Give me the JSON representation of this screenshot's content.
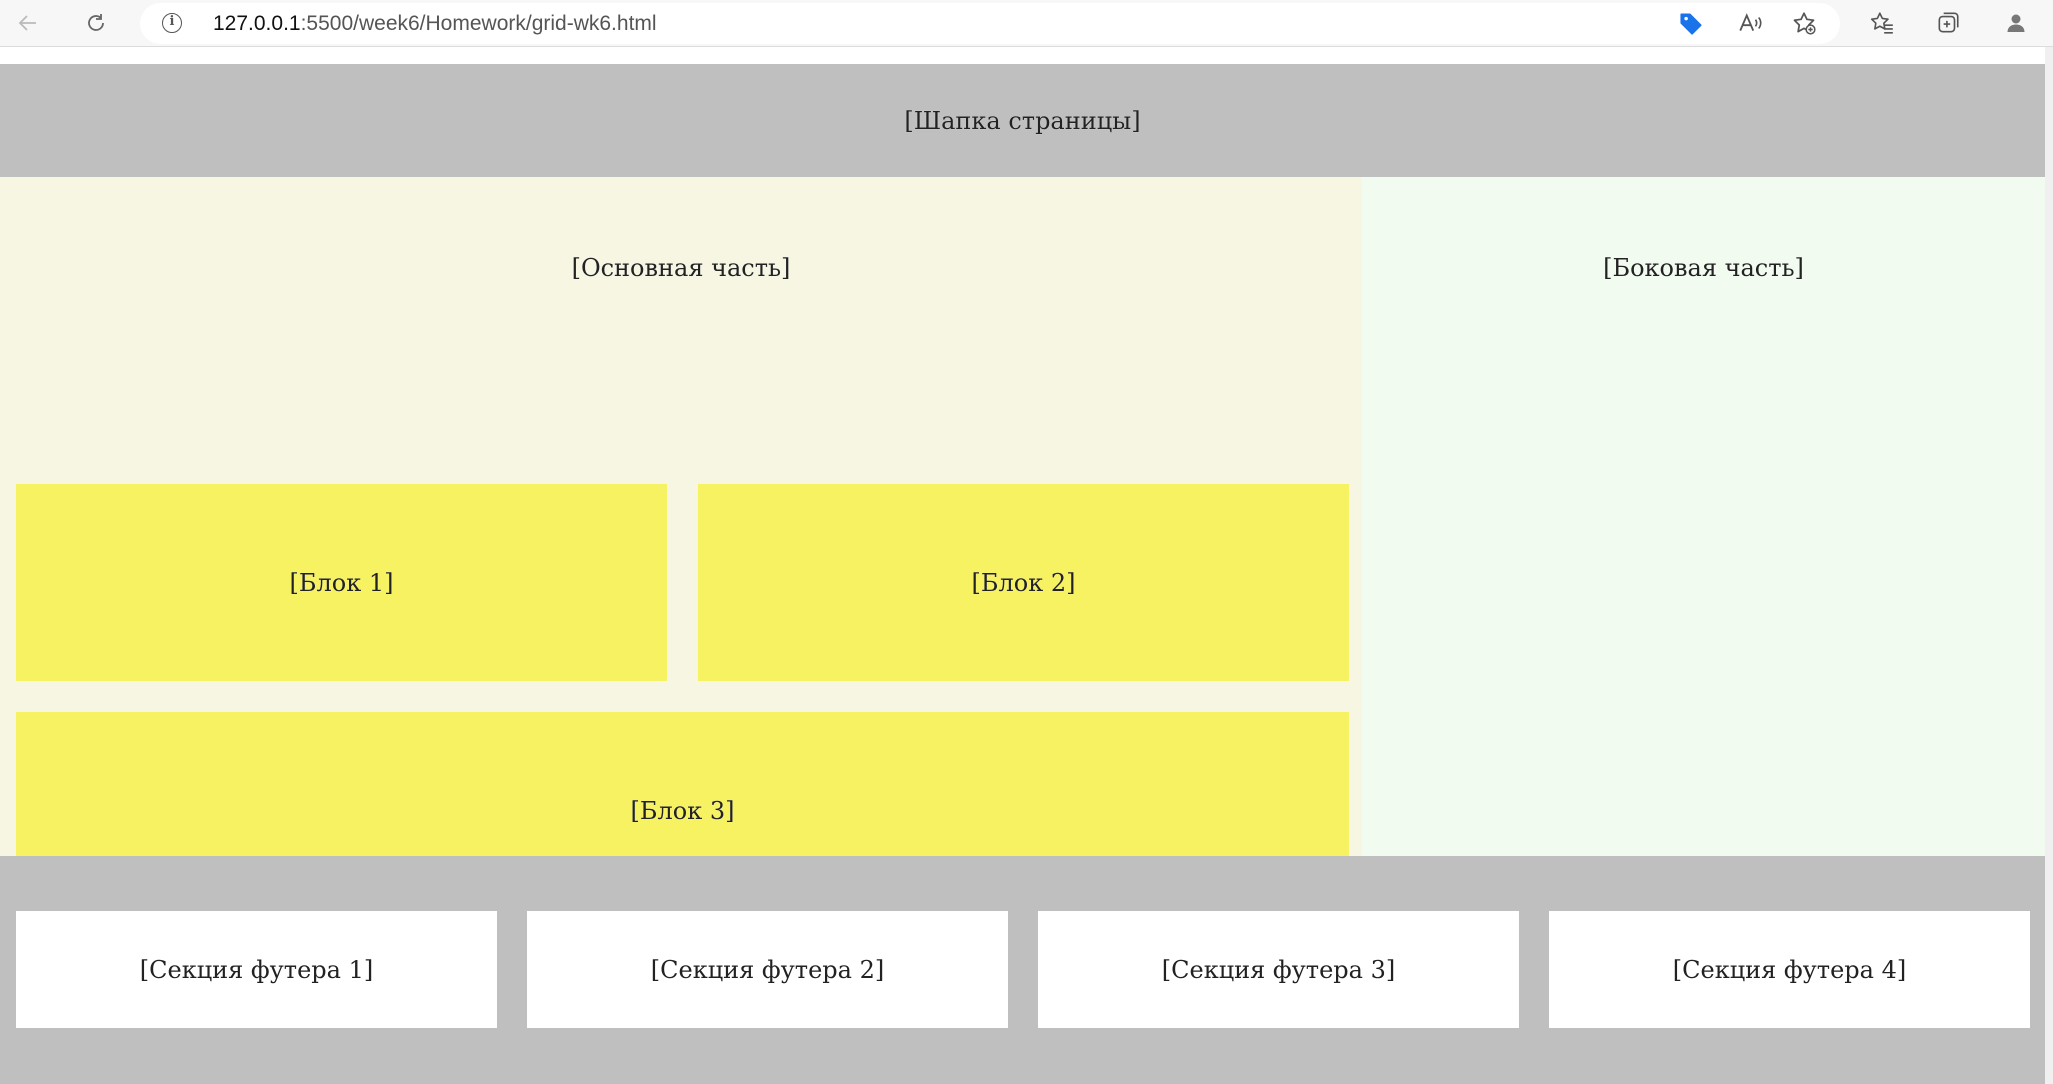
{
  "browser": {
    "url_host": "127.0.0.1",
    "url_path": ":5500/week6/Homework/grid-wk6.html",
    "icons": [
      "back-arrow-icon",
      "refresh-icon",
      "info-icon",
      "tag-icon",
      "read-aloud-icon",
      "add-favorite-icon",
      "favorites-icon",
      "collections-icon",
      "profile-icon"
    ],
    "accent_color": "#1a73e8"
  },
  "page": {
    "header": "[Шапка страницы]",
    "main": "[Основная часть]",
    "aside": "[Боковая часть]",
    "blocks": [
      "[Блок 1]",
      "[Блок 2]",
      "[Блок 3]"
    ],
    "footer_sections": [
      "[Секция футера 1]",
      "[Секция футера 2]",
      "[Секция футера 3]",
      "[Секция футера 4]"
    ],
    "colors": {
      "header": "#bfbfbf",
      "main": "#f6f6e3",
      "aside": "#f1fbf0",
      "block": "#f6f261",
      "footer": "#bfbfbf",
      "footer_section": "#ffffff"
    }
  }
}
